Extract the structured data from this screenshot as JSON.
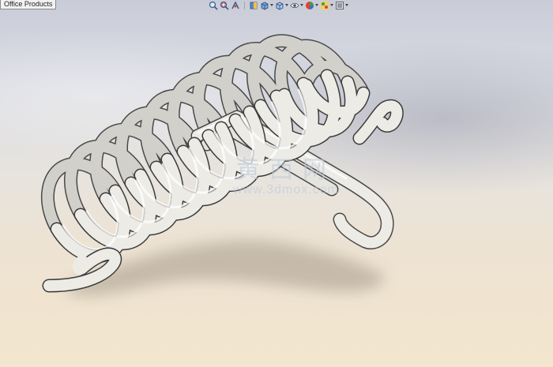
{
  "viewport": {
    "tab_label": "Office Products",
    "background_top": "#c9ccd8",
    "background_bottom": "#f3e6cf",
    "model_color": "#e9e7e1"
  },
  "toolbar": {
    "buttons": [
      {
        "icon": "zoom-to-fit-icon"
      },
      {
        "icon": "zoom-to-area-icon"
      },
      {
        "icon": "previous-view-icon"
      },
      {
        "icon": "section-view-icon"
      },
      {
        "icon": "view-orientation-icon"
      },
      {
        "icon": "display-style-icon"
      },
      {
        "icon": "hide-show-items-icon"
      },
      {
        "icon": "edit-appearance-icon"
      },
      {
        "icon": "apply-scene-icon"
      },
      {
        "icon": "view-settings-icon"
      }
    ]
  },
  "watermark": {
    "logo": "黄西网",
    "url": "www.3dmox.com"
  }
}
